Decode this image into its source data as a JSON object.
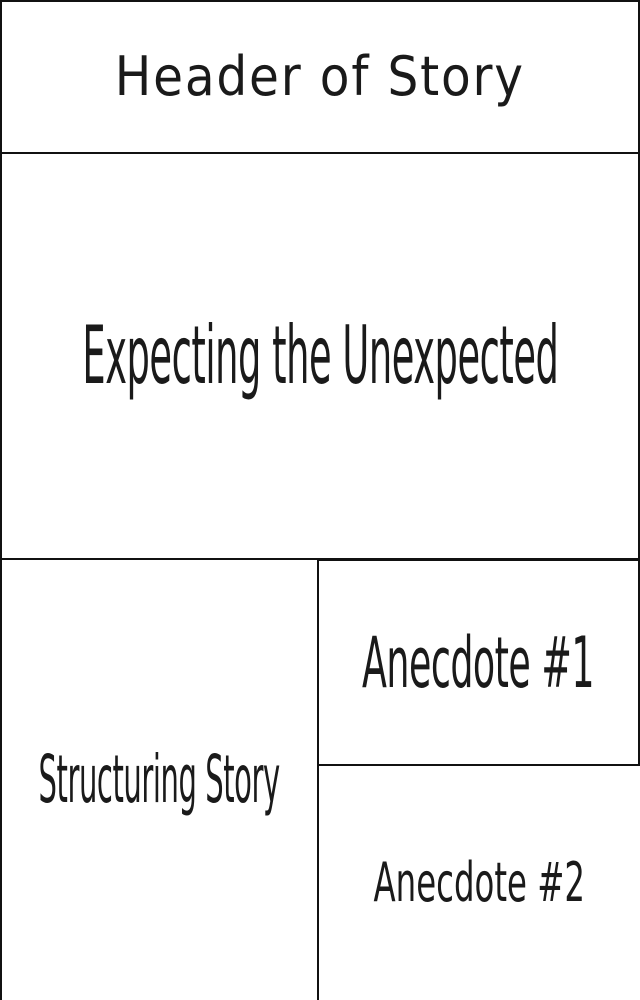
{
  "panels": {
    "header": "Header of Story",
    "main": "Expecting the Unexpected",
    "left": "Structuring Story",
    "anecdote_1": "Anecdote #1",
    "anecdote_2": "Anecdote #2"
  },
  "colors": {
    "border": "#111111",
    "text": "#1a1a1a",
    "background": "#ffffff"
  }
}
